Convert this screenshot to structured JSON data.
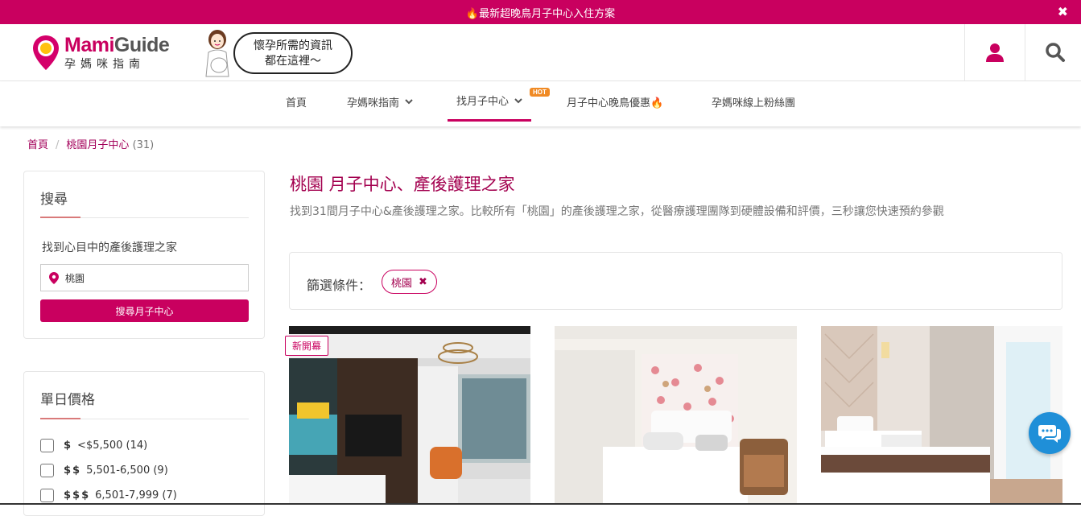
{
  "topbar": {
    "text": "🔥最新超晚鳥月子中心入住方案",
    "close": "✖"
  },
  "logo": {
    "brand_main": "Mami",
    "brand_second": "Guide",
    "subtitle": "孕媽咪指南"
  },
  "bubble": {
    "line1": "懷孕所需的資訊",
    "line2": "都在這裡～"
  },
  "nav": {
    "items": [
      {
        "label": "首頁"
      },
      {
        "label": "孕媽咪指南"
      },
      {
        "label": "找月子中心"
      },
      {
        "label": "月子中心晚鳥優惠🔥"
      },
      {
        "label": "孕媽咪線上粉絲團"
      }
    ],
    "hot_badge": "HOT"
  },
  "breadcrumb": {
    "home": "首頁",
    "current": "桃園月子中心",
    "count": "(31)"
  },
  "sidebar": {
    "search": {
      "title": "搜尋",
      "desc": "找到心目中的產後護理之家",
      "location_value": "桃園",
      "button": "搜尋月子中心"
    },
    "price": {
      "title": "單日價格",
      "options": [
        {
          "sign": "$",
          "label": "<$5,500 (14)"
        },
        {
          "sign": "$$",
          "label": "5,501-6,500 (9)"
        },
        {
          "sign": "$$$",
          "label": "6,501-7,999 (7)"
        }
      ]
    }
  },
  "main": {
    "title": "桃園 月子中心、產後護理之家",
    "desc": "找到31間月子中心&產後護理之家。比較所有「桃園」的產後護理之家，從醫療護理團隊到硬體設備和評價，三秒讓您快速預約參觀",
    "filter_label": "篩選條件：",
    "filter_tag": "桃園",
    "new_badge": "新開幕"
  },
  "colors": {
    "brand": "#c9005f",
    "chat": "#1f8fd8"
  }
}
